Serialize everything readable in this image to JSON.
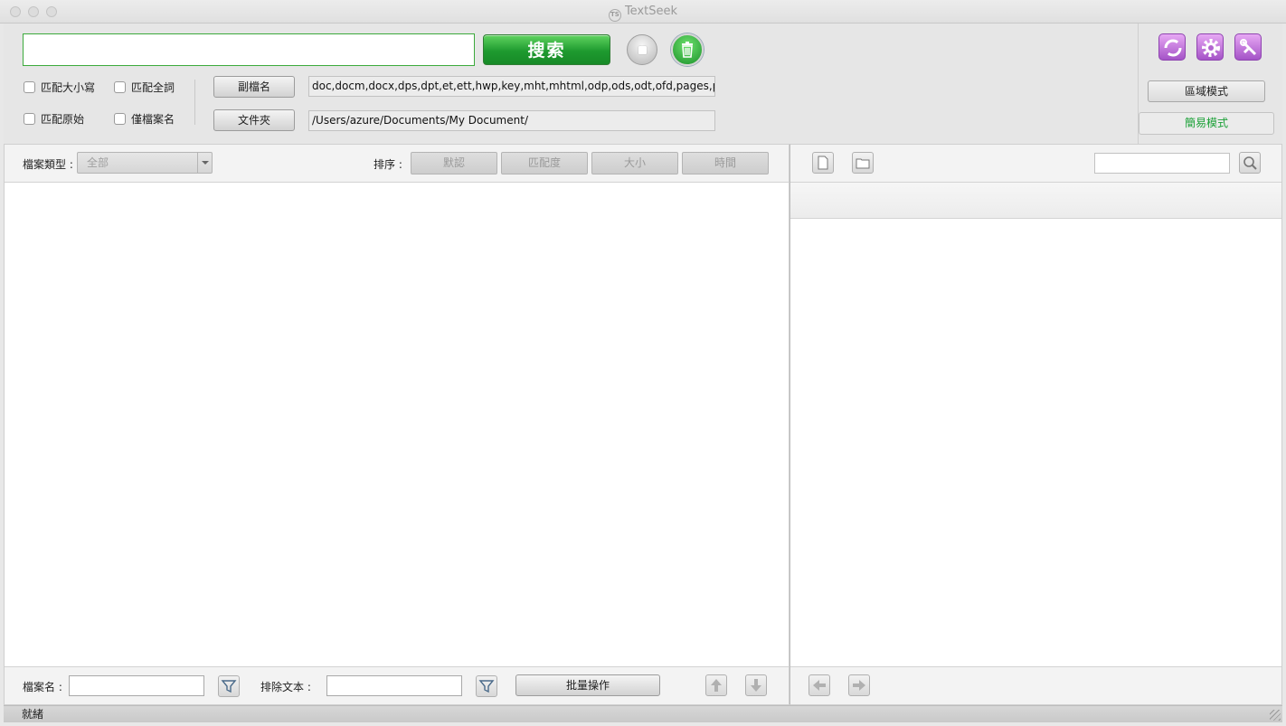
{
  "window": {
    "title": "TextSeek",
    "logo_text": "TS"
  },
  "search": {
    "value": "",
    "button_label": "搜索"
  },
  "options": {
    "match_case": "匹配大小寫",
    "match_whole_word": "匹配全詞",
    "match_original": "匹配原始",
    "filename_only": "僅檔案名"
  },
  "extensions": {
    "button_label": "副檔名",
    "value": "doc,docm,docx,dps,dpt,et,ett,hwp,key,mht,mhtml,odp,ods,odt,ofd,pages,pdf,ppt,pptm"
  },
  "folder": {
    "button_label": "文件夾",
    "value": "/Users/azure/Documents/My Document/"
  },
  "modes": {
    "region_mode": "區域模式",
    "simple_mode": "簡易模式"
  },
  "results_toolbar": {
    "filetype_label": "檔案類型 :",
    "filetype_value": "全部",
    "sort_label": "排序 :",
    "sort_buttons": [
      "默認",
      "匹配度",
      "大小",
      "時間"
    ]
  },
  "bottom": {
    "filename_label": "檔案名 :",
    "filename_value": "",
    "exclude_label": "排除文本 :",
    "exclude_value": "",
    "batch_label": "批量操作"
  },
  "preview": {
    "search_value": ""
  },
  "status": {
    "text": "就緒"
  },
  "colors": {
    "accent_green": "#1e9a2f",
    "tool_purple": "#a453c7",
    "mode_green": "#1aa036"
  }
}
